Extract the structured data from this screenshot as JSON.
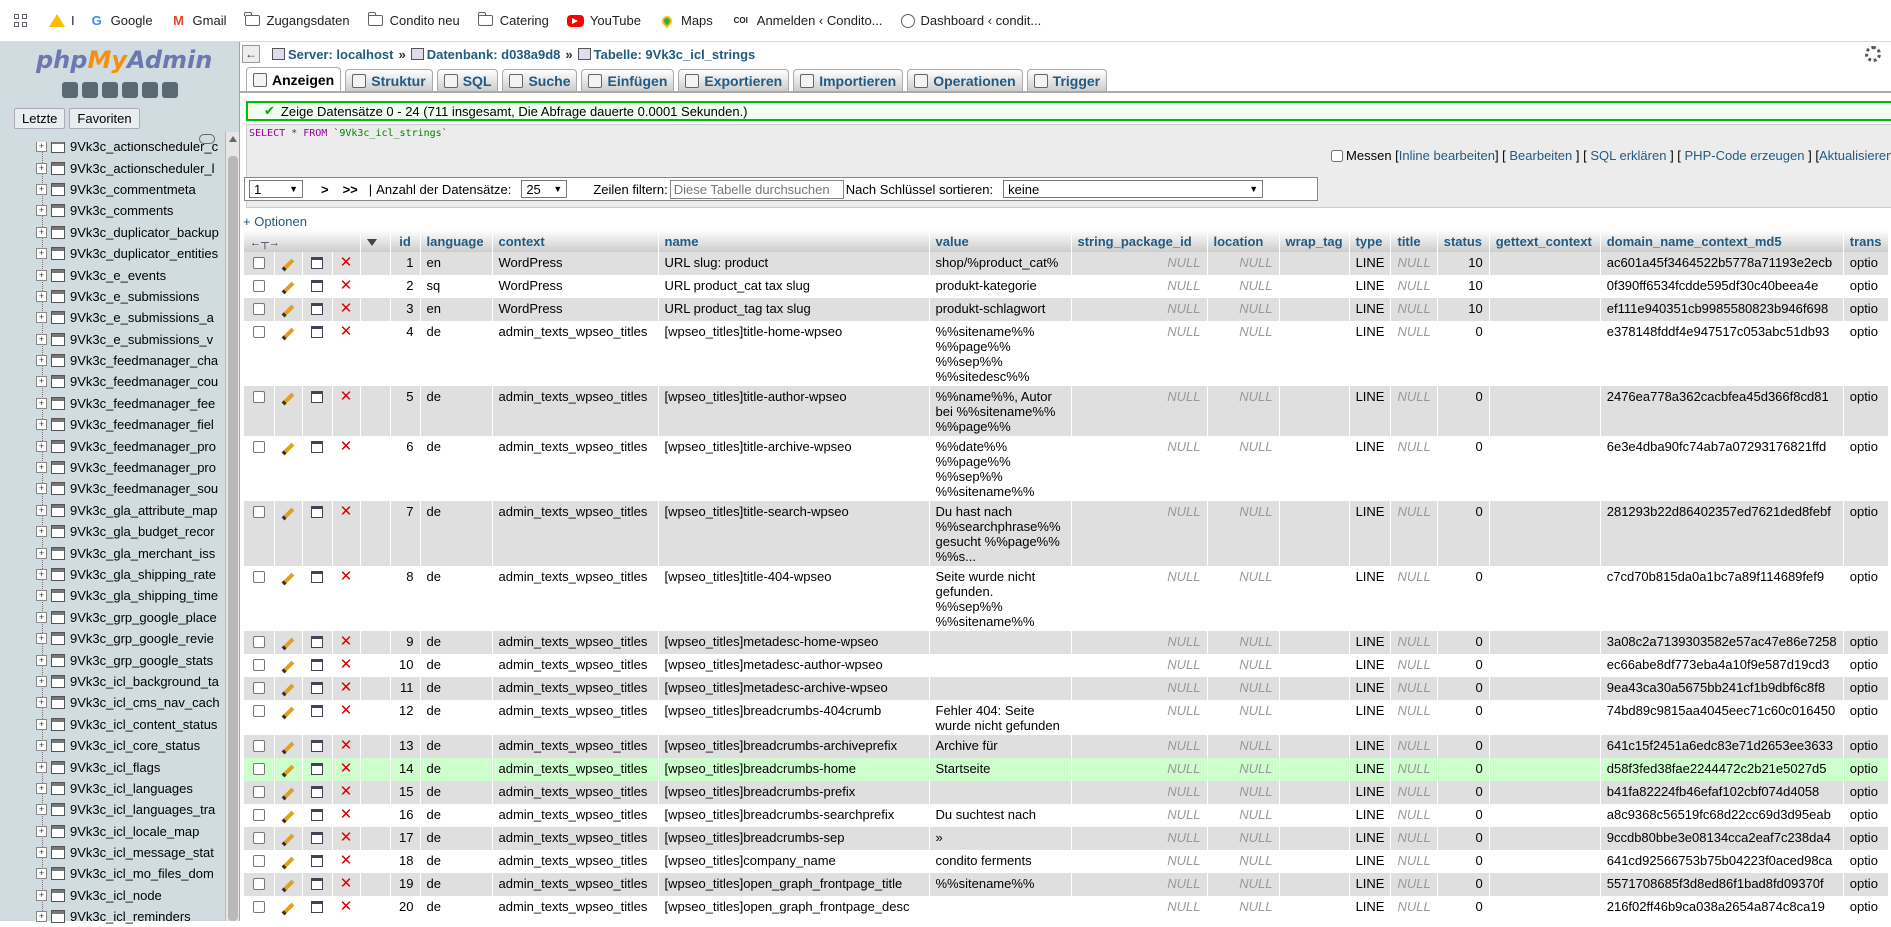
{
  "bookmarks": {
    "items": [
      {
        "label": "I",
        "icon": "google-drive-icon",
        "color": "#1a73e8"
      },
      {
        "label": "Google",
        "icon": "google-icon",
        "color": "#4285f4"
      },
      {
        "label": "Gmail",
        "icon": "gmail-icon",
        "color": "#ea4335"
      },
      {
        "label": "Zugangsdaten",
        "icon": "folder-icon"
      },
      {
        "label": "Condito neu",
        "icon": "folder-icon"
      },
      {
        "label": "Catering",
        "icon": "folder-icon"
      },
      {
        "label": "YouTube",
        "icon": "youtube-icon",
        "color": "#ff0000"
      },
      {
        "label": "Maps",
        "icon": "maps-icon"
      },
      {
        "label": "Anmelden ‹ Condito...",
        "icon": "condito-icon",
        "icon_text": "COI"
      },
      {
        "label": "Dashboard ‹ condit...",
        "icon": "wordpress-icon"
      }
    ]
  },
  "sidebar": {
    "logo": {
      "php": "php",
      "my": "My",
      "admin": "Admin"
    },
    "tabs": [
      "Letzte",
      "Favoriten"
    ],
    "tables": [
      "9Vk3c_actionscheduler_c",
      "9Vk3c_actionscheduler_l",
      "9Vk3c_commentmeta",
      "9Vk3c_comments",
      "9Vk3c_duplicator_backup",
      "9Vk3c_duplicator_entities",
      "9Vk3c_e_events",
      "9Vk3c_e_submissions",
      "9Vk3c_e_submissions_a",
      "9Vk3c_e_submissions_v",
      "9Vk3c_feedmanager_cha",
      "9Vk3c_feedmanager_cou",
      "9Vk3c_feedmanager_fee",
      "9Vk3c_feedmanager_fiel",
      "9Vk3c_feedmanager_pro",
      "9Vk3c_feedmanager_pro",
      "9Vk3c_feedmanager_sou",
      "9Vk3c_gla_attribute_map",
      "9Vk3c_gla_budget_recor",
      "9Vk3c_gla_merchant_iss",
      "9Vk3c_gla_shipping_rate",
      "9Vk3c_gla_shipping_time",
      "9Vk3c_grp_google_place",
      "9Vk3c_grp_google_revie",
      "9Vk3c_grp_google_stats",
      "9Vk3c_icl_background_ta",
      "9Vk3c_icl_cms_nav_cach",
      "9Vk3c_icl_content_status",
      "9Vk3c_icl_core_status",
      "9Vk3c_icl_flags",
      "9Vk3c_icl_languages",
      "9Vk3c_icl_languages_tra",
      "9Vk3c_icl_locale_map",
      "9Vk3c_icl_message_stat",
      "9Vk3c_icl_mo_files_dom",
      "9Vk3c_icl_node",
      "9Vk3c_icl_reminders"
    ]
  },
  "breadcrumb": {
    "server": "Server: localhost",
    "database": "Datenbank: d038a9d8",
    "table": "Tabelle: 9Vk3c_icl_strings",
    "sep": "»"
  },
  "tabs": [
    "Anzeigen",
    "Struktur",
    "SQL",
    "Suche",
    "Einfügen",
    "Exportieren",
    "Importieren",
    "Operationen",
    "Trigger"
  ],
  "message": "Zeige Datensätze 0 - 24 (711 insgesamt, Die Abfrage dauerte 0.0001 Sekunden.)",
  "sql": {
    "select": "SELECT",
    "star": " * ",
    "from": "FROM",
    "table": "`9Vk3c_icl_strings`"
  },
  "sql_links": {
    "profiling": "Messen",
    "inline_edit": "Inline bearbeiten",
    "edit": "Bearbeiten",
    "explain": "SQL erklären",
    "php_code": "PHP-Code erzeugen",
    "refresh": "Aktualisieren"
  },
  "navigation": {
    "page": "1",
    "next": ">",
    "last": ">>",
    "rows_label": "Anzahl der Datensätze:",
    "rows_value": "25",
    "filter_label": "Zeilen filtern:",
    "filter_placeholder": "Diese Tabelle durchsuchen",
    "sort_label": "Nach Schlüssel sortieren:",
    "sort_value": "keine"
  },
  "options_link": "+ Optionen",
  "columns": [
    "id",
    "language",
    "context",
    "name",
    "value",
    "string_package_id",
    "location",
    "wrap_tag",
    "type",
    "title",
    "status",
    "gettext_context",
    "domain_name_context_md5",
    "trans"
  ],
  "null_text": "NULL",
  "rows": [
    {
      "id": "1",
      "language": "en",
      "context": "WordPress",
      "name": "URL slug: product",
      "value": "shop/%product_cat%",
      "type": "LINE",
      "status": "10",
      "md5": "ac601a45f3464522b5778a71193e2ecb",
      "trans": "optio"
    },
    {
      "id": "2",
      "language": "sq",
      "context": "WordPress",
      "name": "URL product_cat tax slug",
      "value": "produkt-kategorie",
      "type": "LINE",
      "status": "10",
      "md5": "0f390ff6534fcdde595df30c40beea4e",
      "trans": "optio"
    },
    {
      "id": "3",
      "language": "en",
      "context": "WordPress",
      "name": "URL product_tag tax slug",
      "value": "produkt-schlagwort",
      "type": "LINE",
      "status": "10",
      "md5": "ef111e940351cb9985580823b946f698",
      "trans": "optio"
    },
    {
      "id": "4",
      "language": "de",
      "context": "admin_texts_wpseo_titles",
      "name": "[wpseo_titles]title-home-wpseo",
      "value": "%%sitename%%\n%%page%%\n%%sep%%\n%%sitedesc%%",
      "type": "LINE",
      "status": "0",
      "md5": "e378148fddf4e947517c053abc51db93",
      "trans": "optio"
    },
    {
      "id": "5",
      "language": "de",
      "context": "admin_texts_wpseo_titles",
      "name": "[wpseo_titles]title-author-wpseo",
      "value": "%%name%%, Autor\nbei %%sitename%%\n%%page%%",
      "type": "LINE",
      "status": "0",
      "md5": "2476ea778a362cacbfea45d366f8cd81",
      "trans": "optio"
    },
    {
      "id": "6",
      "language": "de",
      "context": "admin_texts_wpseo_titles",
      "name": "[wpseo_titles]title-archive-wpseo",
      "value": "%%date%%\n%%page%%\n%%sep%%\n%%sitename%%",
      "type": "LINE",
      "status": "0",
      "md5": "6e3e4dba90fc74ab7a07293176821ffd",
      "trans": "optio"
    },
    {
      "id": "7",
      "language": "de",
      "context": "admin_texts_wpseo_titles",
      "name": "[wpseo_titles]title-search-wpseo",
      "value": "Du hast nach\n%%searchphrase%%\ngesucht %%page%%\n%%s...",
      "type": "LINE",
      "status": "0",
      "md5": "281293b22d86402357ed7621ded8febf",
      "trans": "optio"
    },
    {
      "id": "8",
      "language": "de",
      "context": "admin_texts_wpseo_titles",
      "name": "[wpseo_titles]title-404-wpseo",
      "value": "Seite wurde nicht\ngefunden.\n%%sep%%\n%%sitename%%",
      "type": "LINE",
      "status": "0",
      "md5": "c7cd70b815da0a1bc7a89f114689fef9",
      "trans": "optio"
    },
    {
      "id": "9",
      "language": "de",
      "context": "admin_texts_wpseo_titles",
      "name": "[wpseo_titles]metadesc-home-wpseo",
      "value": "",
      "type": "LINE",
      "status": "0",
      "md5": "3a08c2a7139303582e57ac47e86e7258",
      "trans": "optio"
    },
    {
      "id": "10",
      "language": "de",
      "context": "admin_texts_wpseo_titles",
      "name": "[wpseo_titles]metadesc-author-wpseo",
      "value": "",
      "type": "LINE",
      "status": "0",
      "md5": "ec66abe8df773eba4a10f9e587d19cd3",
      "trans": "optio"
    },
    {
      "id": "11",
      "language": "de",
      "context": "admin_texts_wpseo_titles",
      "name": "[wpseo_titles]metadesc-archive-wpseo",
      "value": "",
      "type": "LINE",
      "status": "0",
      "md5": "9ea43ca30a5675bb241cf1b9dbf6c8f8",
      "trans": "optio"
    },
    {
      "id": "12",
      "language": "de",
      "context": "admin_texts_wpseo_titles",
      "name": "[wpseo_titles]breadcrumbs-404crumb",
      "value": "Fehler 404: Seite\nwurde nicht gefunden",
      "type": "LINE",
      "status": "0",
      "md5": "74bd89c9815aa4045eec71c60c016450",
      "trans": "optio"
    },
    {
      "id": "13",
      "language": "de",
      "context": "admin_texts_wpseo_titles",
      "name": "[wpseo_titles]breadcrumbs-archiveprefix",
      "value": "Archive für",
      "type": "LINE",
      "status": "0",
      "md5": "641c15f2451a6edc83e71d2653ee3633",
      "trans": "optio"
    },
    {
      "id": "14",
      "language": "de",
      "context": "admin_texts_wpseo_titles",
      "name": "[wpseo_titles]breadcrumbs-home",
      "value": "Startseite",
      "type": "LINE",
      "status": "0",
      "md5": "d58f3fed38fae2244472c2b21e5027d5",
      "trans": "optio",
      "highlight": true
    },
    {
      "id": "15",
      "language": "de",
      "context": "admin_texts_wpseo_titles",
      "name": "[wpseo_titles]breadcrumbs-prefix",
      "value": "",
      "type": "LINE",
      "status": "0",
      "md5": "b41fa82224fb46efaf102cbf074d4058",
      "trans": "optio"
    },
    {
      "id": "16",
      "language": "de",
      "context": "admin_texts_wpseo_titles",
      "name": "[wpseo_titles]breadcrumbs-searchprefix",
      "value": "Du suchtest nach",
      "type": "LINE",
      "status": "0",
      "md5": "a8c9368c56519fc68d22cc69d3d95eab",
      "trans": "optio"
    },
    {
      "id": "17",
      "language": "de",
      "context": "admin_texts_wpseo_titles",
      "name": "[wpseo_titles]breadcrumbs-sep",
      "value": "»",
      "type": "LINE",
      "status": "0",
      "md5": "9ccdb80bbe3e08134cca2eaf7c238da4",
      "trans": "optio"
    },
    {
      "id": "18",
      "language": "de",
      "context": "admin_texts_wpseo_titles",
      "name": "[wpseo_titles]company_name",
      "value": "condito ferments",
      "type": "LINE",
      "status": "0",
      "md5": "641cd92566753b75b04223f0aced98ca",
      "trans": "optio"
    },
    {
      "id": "19",
      "language": "de",
      "context": "admin_texts_wpseo_titles",
      "name": "[wpseo_titles]open_graph_frontpage_title",
      "value": "%%sitename%%",
      "type": "LINE",
      "status": "0",
      "md5": "5571708685f3d8ed86f1bad8fd09370f",
      "trans": "optio"
    },
    {
      "id": "20",
      "language": "de",
      "context": "admin_texts_wpseo_titles",
      "name": "[wpseo_titles]open_graph_frontpage_desc",
      "value": "",
      "type": "LINE",
      "status": "0",
      "md5": "216f02ff46b9ca038a2654a874c8ca19",
      "trans": "optio"
    }
  ],
  "colors": {
    "link": "#235a81",
    "highlight_row": "#ccffcc",
    "even_row": "#dfdfdf",
    "success_border": "#00c000"
  }
}
